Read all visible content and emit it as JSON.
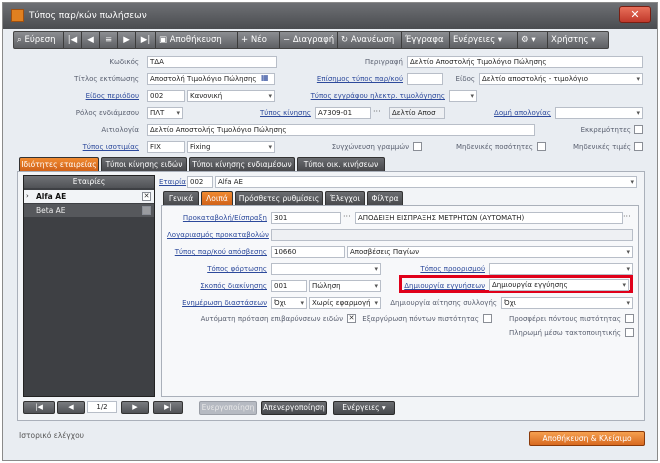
{
  "window": {
    "title": "Τύπος παρ/κών πωλήσεων",
    "close": "✕"
  },
  "toolbar": {
    "search": "Εύρεση",
    "prev_first": "|◀",
    "prev": "◀",
    "list": "≡",
    "next": "▶",
    "next_last": "▶|",
    "save": "Αποθήκευση",
    "new": "Νέο",
    "delete": "Διαγραφή",
    "refresh": "Ανανέωση",
    "documents": "Έγγραφα",
    "actions": "Ενέργειες",
    "users": "Χρήστης"
  },
  "form": {
    "code_label": "Κωδικός",
    "code": "ΤΔΑ",
    "desc_label": "Περιγραφή",
    "desc": "Δελτίο Αποστολής Τιμολόγιο Πώλησης",
    "print_title_label": "Τίτλος εκτύπωσης",
    "print_title": "Αποστολή Τιμολόγιο Πώλησης",
    "extra_type_label": "Επίσημος τύπος παρ/κού",
    "extra_type": "",
    "kind_label": "Είδος",
    "kind": "Δελτίο αποστολής - τιμολόγιο",
    "period_kind_label": "Είδος περιόδου",
    "period_code": "002",
    "period_name": "Κανονική",
    "edoc_type_label": "Τύπος εγγράφου ηλεκτρ. τιμολόγησης",
    "edoc_type": "",
    "role_label": "Ρόλος ενδιάμεσου",
    "role": "ΠΛΤ",
    "movement_type_label": "Τύπος κίνησης",
    "movement_type": "Α7309-01",
    "movement_name": "Δελτίο Αποσ",
    "approval_label": "Δομή απολογίας",
    "approval": "",
    "reason_label": "Αιτιολογία",
    "reason": "Δελτίο Αποστολής Τιμολόγιο Πώλησης",
    "pending_label": "Εκκρεμότητες",
    "pricelist_label": "Τύπος ισοτιμίας",
    "pricelist_code": "FIX",
    "pricelist_name": "Fixing",
    "merge_lines_label": "Συγχώνευση γραμμών",
    "zero_qty_label": "Μηδενικές ποσότητες",
    "zero_price_label": "Μηδενικές τιμές"
  },
  "tabs": [
    "Ιδιότητες εταιρείας",
    "Τύποι κίνησης ειδών",
    "Τύποι κίνησης ενδιαμέσων",
    "Τύποι οικ. κινήσεων"
  ],
  "companies": {
    "header": "Εταιρίες",
    "rows": [
      {
        "name": "Alfa AE"
      },
      {
        "name": "Beta AE"
      }
    ]
  },
  "company": {
    "label": "Εταιρία",
    "code": "002",
    "name": "Alfa AE"
  },
  "subtabs": [
    "Γενικά",
    "Λοιπά",
    "Πρόσθετες ρυθμίσεις",
    "Έλεγχοι",
    "Φίλτρα"
  ],
  "other": {
    "prepay_label": "Προκαταβολή/Είσπραξη",
    "prepay_code": "301",
    "prepay_name": "ΑΠΟΔΕΙΞΗ ΕΙΣΠΡΑΞΗΣ ΜΕΤΡΗΤΩΝ (ΑΥΤΟΜΑΤΗ)",
    "prepay_acc_label": "Λογαριασμός προκαταβολών",
    "prepay_acc": "",
    "alt_doc_label": "Τύπος παρ/κού απόσβεσης",
    "alt_doc_code": "10660",
    "alt_doc_name": "Αποσβέσεις Παγίων",
    "load_place_label": "Τόπος φόρτωσης",
    "load_place": "",
    "dest_label": "Τόπος προορισμού",
    "dest": "",
    "transfer_label": "Σκοπός διακίνησης",
    "transfer_code": "001",
    "transfer_name": "Πώληση",
    "create_guarantee_label": "Δημιουργία εγγυήσεων",
    "create_guarantee": "Δημιουργία εγγύησης",
    "update_stock_label": "Ενημέρωση διαστάσεων",
    "update_stock": "Όχι",
    "update_stock_2": "Χωρίς εφαρμογή",
    "collect_label": "Δημιουργία αίτησης συλλογής",
    "collect": "Όχι",
    "auto_proposal_label": "Αυτόματη πρόταση επιβαρύνσεων ειδών",
    "redeem_label": "Εξαργύρωση πόντων πιστότητας",
    "add_points_label": "Προσφέρει πόντους πιστότητας",
    "pay_tax_label": "Πληρωμή μέσω τακτοποιητικής"
  },
  "nav": {
    "first": "|◀",
    "prev": "◀",
    "page": "1/2",
    "next": "▶",
    "last": "▶|"
  },
  "buttons": {
    "activate": "Ενεργοποίηση",
    "deactivate": "Απενεργοποίηση",
    "actions": "Ενέργειες",
    "save_close": "Αποθήκευση & Κλείσιμο"
  },
  "footer": {
    "history": "Ιστορικό ελέγχου"
  }
}
